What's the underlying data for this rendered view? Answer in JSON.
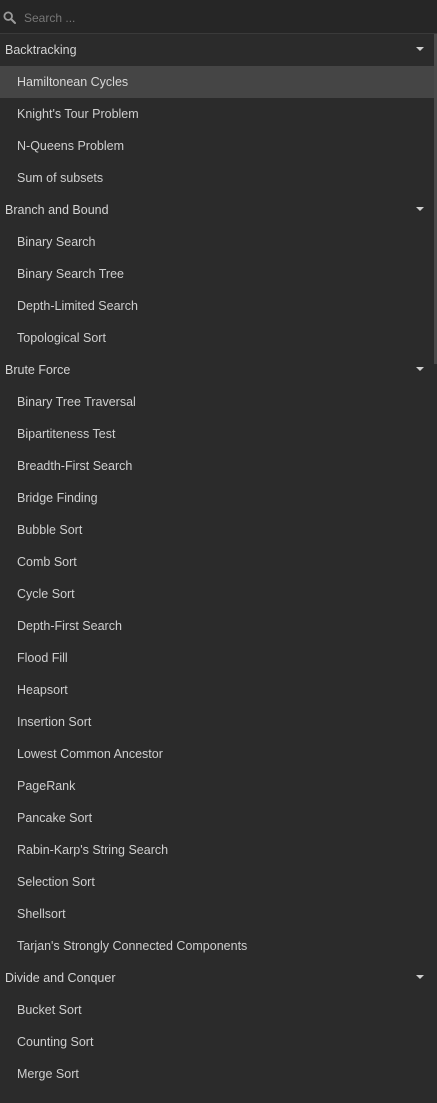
{
  "search": {
    "placeholder": "Search ..."
  },
  "categories": [
    {
      "title": "Backtracking",
      "items": [
        "Hamiltonean Cycles",
        "Knight's Tour Problem",
        "N-Queens Problem",
        "Sum of subsets"
      ],
      "active_index": 0
    },
    {
      "title": "Branch and Bound",
      "items": [
        "Binary Search",
        "Binary Search Tree",
        "Depth-Limited Search",
        "Topological Sort"
      ],
      "active_index": -1
    },
    {
      "title": "Brute Force",
      "items": [
        "Binary Tree Traversal",
        "Bipartiteness Test",
        "Breadth-First Search",
        "Bridge Finding",
        "Bubble Sort",
        "Comb Sort",
        "Cycle Sort",
        "Depth-First Search",
        "Flood Fill",
        "Heapsort",
        "Insertion Sort",
        "Lowest Common Ancestor",
        "PageRank",
        "Pancake Sort",
        "Rabin-Karp's String Search",
        "Selection Sort",
        "Shellsort",
        "Tarjan's Strongly Connected Components"
      ],
      "active_index": -1
    },
    {
      "title": "Divide and Conquer",
      "items": [
        "Bucket Sort",
        "Counting Sort",
        "Merge Sort"
      ],
      "active_index": -1
    }
  ],
  "colors": {
    "background": "#2b2b2b",
    "active_row": "#454545",
    "text": "#cfcfcf"
  }
}
